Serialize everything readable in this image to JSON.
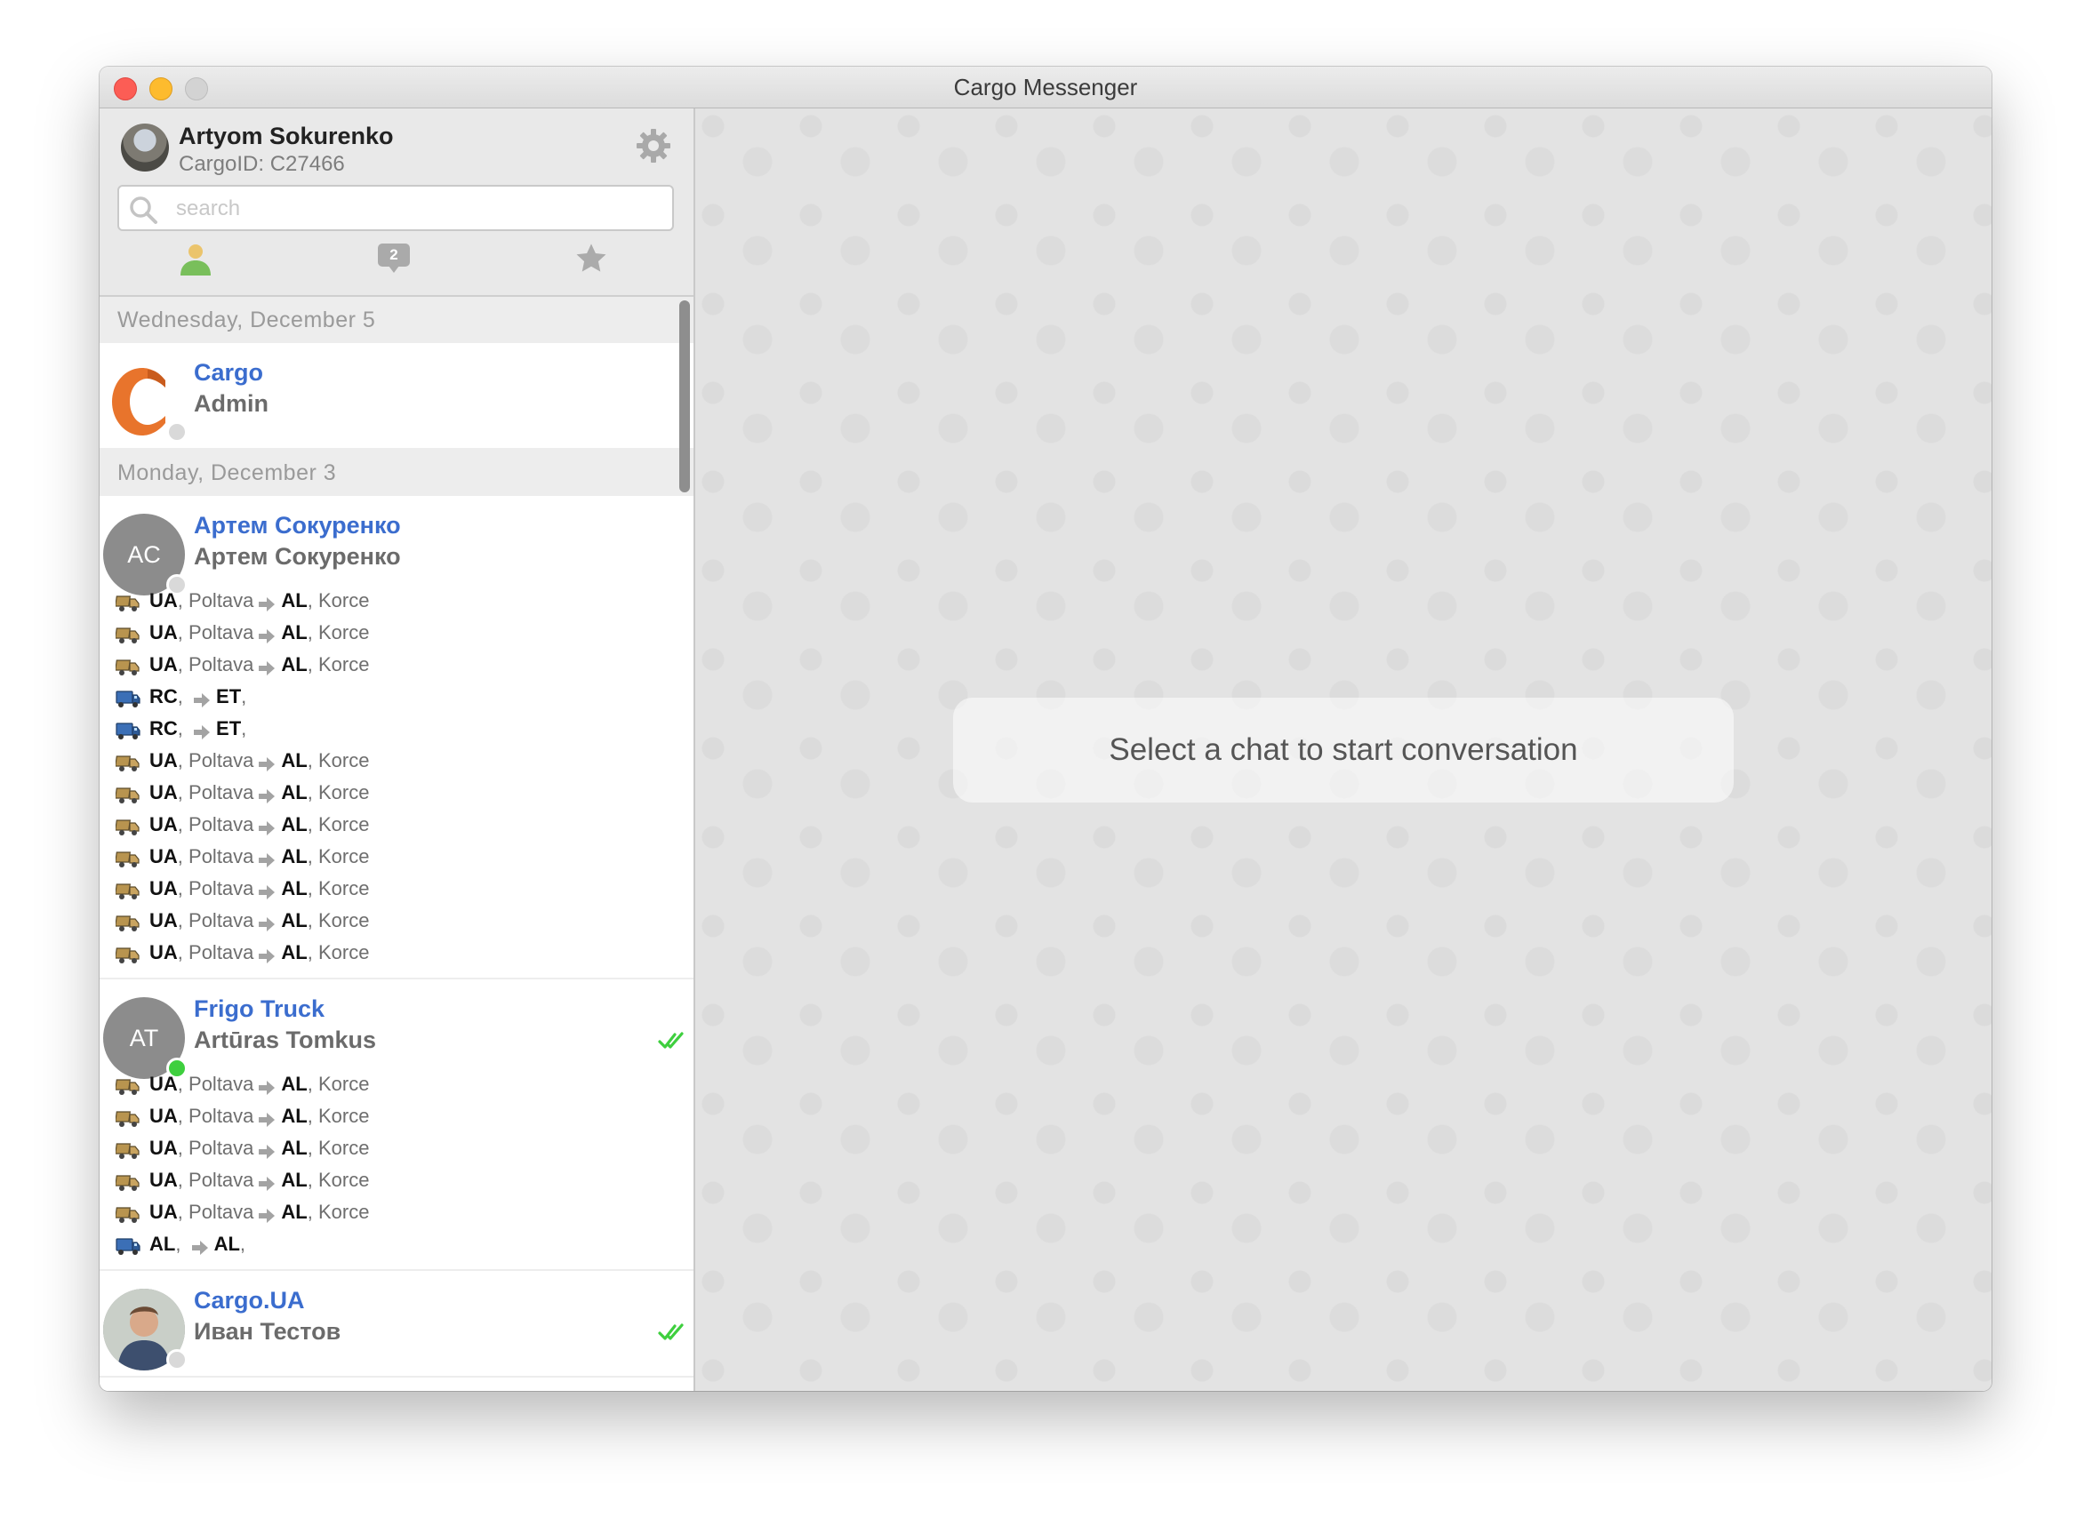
{
  "window": {
    "title": "Cargo Messenger"
  },
  "profile": {
    "name": "Artyom Sokurenko",
    "cargo_id": "CargoID: C27466"
  },
  "search": {
    "placeholder": "search"
  },
  "tabs": {
    "chats_badge": "2"
  },
  "groups": [
    {
      "date": "Wednesday, December 5",
      "chats": [
        {
          "name": "Cargo",
          "person": "Admin",
          "avatar_initials": "",
          "status": "offline",
          "read": false
        }
      ]
    },
    {
      "date": "Monday, December 3",
      "chats": [
        {
          "name": "Артем Сокуренко",
          "person": "Артем Сокуренко",
          "avatar_initials": "AC",
          "status": "offline",
          "read": false,
          "cargo": [
            {
              "type": "van",
              "from": "UA",
              "from_city": "Poltava",
              "to": "AL",
              "to_city": "Korce"
            },
            {
              "type": "van",
              "from": "UA",
              "from_city": "Poltava",
              "to": "AL",
              "to_city": "Korce"
            },
            {
              "type": "van",
              "from": "UA",
              "from_city": "Poltava",
              "to": "AL",
              "to_city": "Korce"
            },
            {
              "type": "truck",
              "from": "RC",
              "from_city": "",
              "to": "ET",
              "to_city": ""
            },
            {
              "type": "truck",
              "from": "RC",
              "from_city": "",
              "to": "ET",
              "to_city": ""
            },
            {
              "type": "van",
              "from": "UA",
              "from_city": "Poltava",
              "to": "AL",
              "to_city": "Korce"
            },
            {
              "type": "van",
              "from": "UA",
              "from_city": "Poltava",
              "to": "AL",
              "to_city": "Korce"
            },
            {
              "type": "van",
              "from": "UA",
              "from_city": "Poltava",
              "to": "AL",
              "to_city": "Korce"
            },
            {
              "type": "van",
              "from": "UA",
              "from_city": "Poltava",
              "to": "AL",
              "to_city": "Korce"
            },
            {
              "type": "van",
              "from": "UA",
              "from_city": "Poltava",
              "to": "AL",
              "to_city": "Korce"
            },
            {
              "type": "van",
              "from": "UA",
              "from_city": "Poltava",
              "to": "AL",
              "to_city": "Korce"
            },
            {
              "type": "van",
              "from": "UA",
              "from_city": "Poltava",
              "to": "AL",
              "to_city": "Korce"
            }
          ]
        },
        {
          "name": "Frigo Truck",
          "person": "Artūras Tomkus",
          "avatar_initials": "AT",
          "status": "online",
          "read": true,
          "cargo": [
            {
              "type": "van",
              "from": "UA",
              "from_city": "Poltava",
              "to": "AL",
              "to_city": "Korce"
            },
            {
              "type": "van",
              "from": "UA",
              "from_city": "Poltava",
              "to": "AL",
              "to_city": "Korce"
            },
            {
              "type": "van",
              "from": "UA",
              "from_city": "Poltava",
              "to": "AL",
              "to_city": "Korce"
            },
            {
              "type": "van",
              "from": "UA",
              "from_city": "Poltava",
              "to": "AL",
              "to_city": "Korce"
            },
            {
              "type": "van",
              "from": "UA",
              "from_city": "Poltava",
              "to": "AL",
              "to_city": "Korce"
            },
            {
              "type": "truck",
              "from": "AL",
              "from_city": "",
              "to": "AL",
              "to_city": ""
            }
          ]
        },
        {
          "name": "Cargo.UA",
          "person": "Иван Тестов",
          "avatar_initials": "",
          "status": "offline",
          "read": true
        }
      ]
    }
  ],
  "main": {
    "placeholder_text": "Select a chat to start conversation"
  },
  "colors": {
    "chat_name": "#3b6dce",
    "online": "#3ecf3e",
    "read_check": "#3ecf3e",
    "close": "#fc5d55",
    "minimize": "#fdbb2e",
    "logo_orange": "#e8742c"
  },
  "icons": {
    "settings": "gear-icon",
    "search": "search-icon",
    "contacts": "person-icon",
    "chats": "chat-bubble-icon",
    "favorites": "star-icon",
    "cargo_van": "van-icon",
    "cargo_truck": "truck-icon",
    "route": "arrow-right-icon",
    "read": "double-check-icon"
  }
}
